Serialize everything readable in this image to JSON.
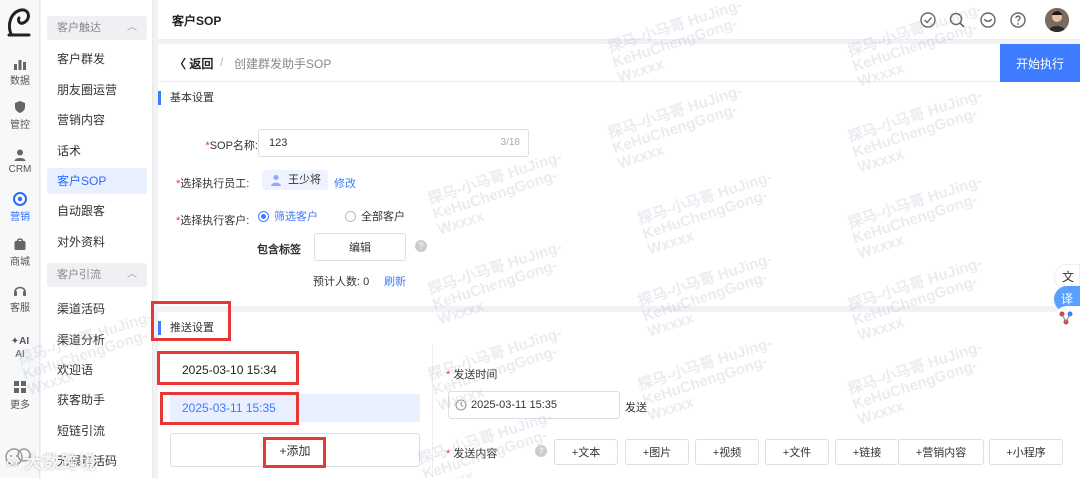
{
  "rail": {
    "items": [
      {
        "label": "数据",
        "icon": "bar-chart-icon"
      },
      {
        "label": "管控",
        "icon": "shield-icon"
      },
      {
        "label": "CRM",
        "icon": "person-icon"
      },
      {
        "label": "营销",
        "icon": "target-icon"
      },
      {
        "label": "商城",
        "icon": "shop-icon"
      },
      {
        "label": "客服",
        "icon": "headset-icon"
      },
      {
        "label": "AI",
        "icon": "ai-icon"
      },
      {
        "label": "更多",
        "icon": "grid-icon"
      }
    ]
  },
  "submenu": {
    "group1": "客户触达",
    "group1_items": [
      "客户群发",
      "朋友圈运营",
      "营销内容",
      "话术",
      "客户SOP",
      "自动跟客",
      "对外资料"
    ],
    "group2": "客户引流",
    "group2_items": [
      "渠道活码",
      "渠道分析",
      "欢迎语",
      "获客助手",
      "短链引流",
      "无限群活码"
    ]
  },
  "header": {
    "title": "客户SOP"
  },
  "breadcrumb": {
    "back": "返回",
    "sep": "/",
    "current": "创建群发助手SOP"
  },
  "start_button": "开始执行",
  "basic": {
    "title": "基本设置",
    "sop_name_label": "SOP名称:",
    "sop_name_value": "123",
    "sop_name_count": "3/18",
    "employee_label": "选择执行员工:",
    "employee_name": "王少将",
    "modify": "修改",
    "customer_label": "选择执行客户:",
    "radio_filter": "筛选客户",
    "radio_all": "全部客户",
    "tags_label": "包含标签",
    "edit": "编辑",
    "estimate_label": "预计人数:",
    "estimate_value": "0",
    "refresh": "刷新",
    "required_mark": "*"
  },
  "push": {
    "title": "推送设置",
    "times": [
      "2025-03-10 15:34",
      "2025-03-11 15:35"
    ],
    "add": "+添加",
    "send_time_label": "发送时间",
    "send_time_value": "2025-03-11 15:35",
    "send_suffix": "发送",
    "send_content_label": "发送内容",
    "content_buttons": [
      "+文本",
      "+图片",
      "+视频",
      "+文件",
      "+链接",
      "+营销内容",
      "+小程序"
    ]
  },
  "floating": {
    "translate_label": "译"
  },
  "watermark": "探马-小马哥 HuJing-\nKeHuChengGong-\nWxxxx",
  "brand_watermark": "大数跨境",
  "colors": {
    "accent": "#3d7cff",
    "highlight": "#e53935"
  }
}
